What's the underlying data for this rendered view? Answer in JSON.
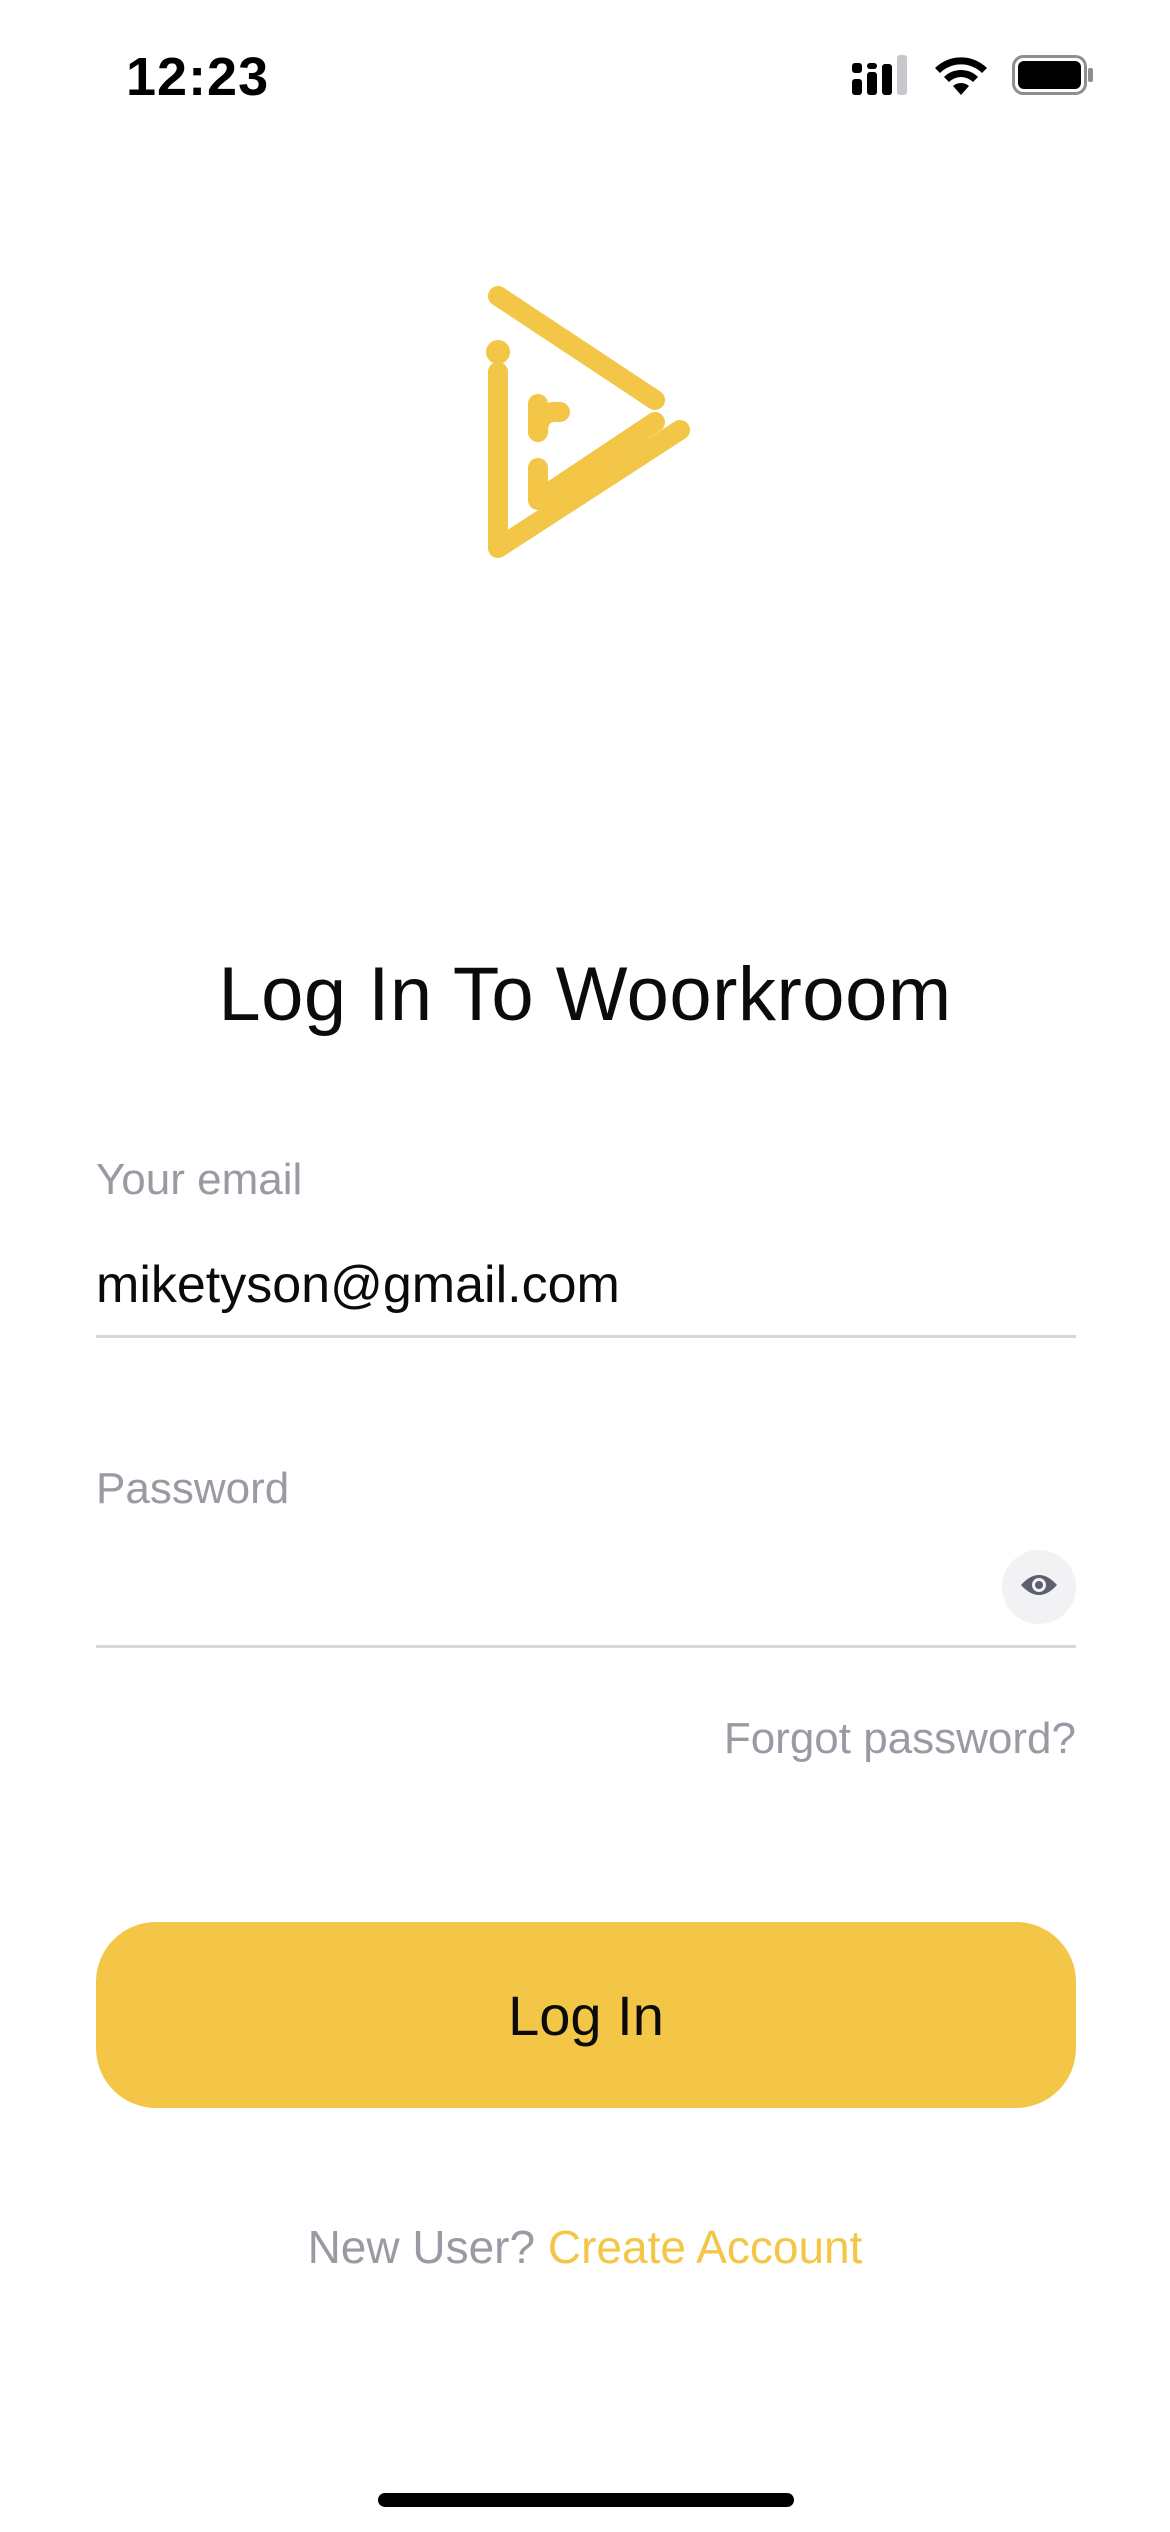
{
  "status_bar": {
    "time": "12:23",
    "icons": [
      "cellular-signal-icon",
      "wifi-icon",
      "battery-icon"
    ]
  },
  "brand": {
    "logo_icon": "play-triangle-logo-icon",
    "accent_color": "#F3C647"
  },
  "page": {
    "title": "Log In To Woorkroom"
  },
  "form": {
    "email": {
      "label": "Your email",
      "value": "miketyson@gmail.com"
    },
    "password": {
      "label": "Password",
      "value": "",
      "toggle_icon": "eye-icon"
    },
    "forgot_password": "Forgot password?",
    "submit_label": "Log In"
  },
  "footer": {
    "prompt": "New User?",
    "link": "Create Account"
  },
  "colors": {
    "text_primary": "#0B0B0B",
    "text_muted": "#9A9AA4",
    "divider": "#D6D6DC",
    "button_bg": "#F3C647"
  }
}
